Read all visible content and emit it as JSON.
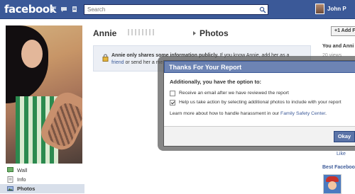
{
  "header": {
    "logo": "facebook",
    "search_placeholder": "Search",
    "profile_name": "John P"
  },
  "left_nav": {
    "items": [
      {
        "label": "Wall",
        "icon": "wall-icon"
      },
      {
        "label": "Info",
        "icon": "info-icon"
      },
      {
        "label": "Photos",
        "icon": "photos-icon",
        "active": true
      }
    ]
  },
  "main": {
    "profile_name": "Annie",
    "section": "Photos",
    "privacy_bold": "Annie only shares some information publicly.",
    "privacy_text": " If you know Annie, add her as a",
    "privacy_link1": "friend",
    "privacy_mid": " or send her a me"
  },
  "right_col": {
    "add_button": "+1 Add F",
    "title": "You and Anni",
    "subtitle": "20 views",
    "like": "Like",
    "best": "Best Faceboo"
  },
  "dialog": {
    "title": "Thanks For Your Report",
    "lead": "Additionally, you have the option to:",
    "options": [
      {
        "label": "Receive an email after we have reviewed the report",
        "checked": false
      },
      {
        "label": "Help us take action by selecting additional photos to include with your report",
        "checked": true
      }
    ],
    "learn_text": "Learn more about how to handle harassment in our ",
    "learn_link": "Family Safety Center",
    "learn_end": ".",
    "okay_label": "Okay"
  },
  "colors": {
    "brand_blue": "#3b5998",
    "dialog_title_bg": "#6d84b4"
  }
}
